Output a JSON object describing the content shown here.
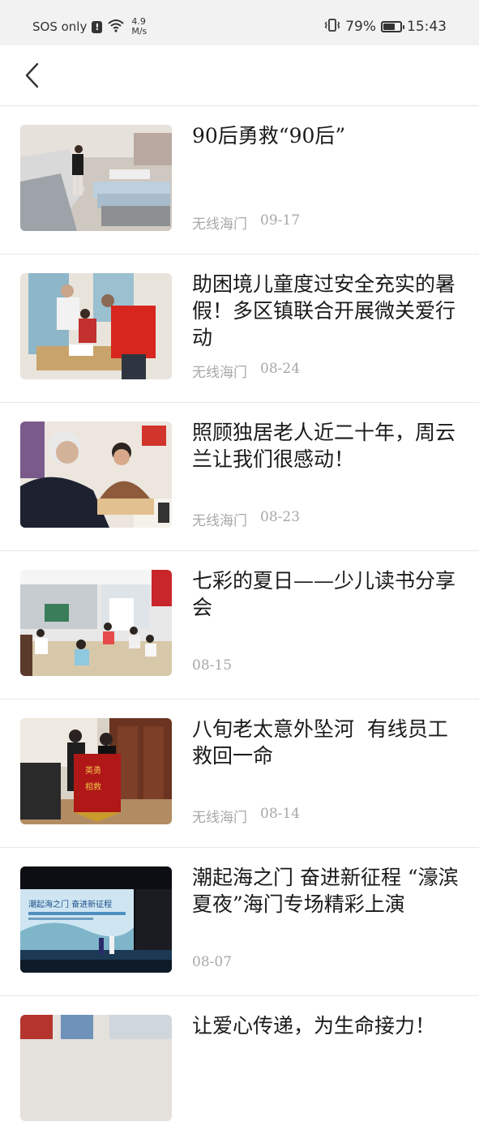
{
  "status_bar": {
    "carrier": "SOS only",
    "speed_value": "4.9",
    "speed_unit": "M/s",
    "battery": "79%",
    "battery_level": 0.79,
    "time": "15:43"
  },
  "nav": {
    "back_icon": "chevron-left-icon"
  },
  "articles": [
    {
      "title": "90后勇救“90后”",
      "source": "无线海门",
      "date": "09-17"
    },
    {
      "title": "助困境儿童度过安全充实的暑假！多区镇联合开展微关爱行动",
      "source": "无线海门",
      "date": "08-24"
    },
    {
      "title": "照顾独居老人近二十年，周云兰让我们很感动！",
      "source": "无线海门",
      "date": "08-23"
    },
    {
      "title": "七彩的夏日——少儿读书分享会",
      "source": "",
      "date": "08-15"
    },
    {
      "title": "八旬老太意外坠河  有线员工救回一命",
      "source": "无线海门",
      "date": "08-14"
    },
    {
      "title": "潮起海之门 奋进新征程 “濠滨夏夜”海门专场精彩上演",
      "source": "",
      "date": "08-07"
    },
    {
      "title": "让爱心传递，为生命接力！",
      "source": "",
      "date": ""
    }
  ],
  "thumb_texts": {
    "stage_banner": "潮起海之门 奋进新征程",
    "banner_chars": "英勇相救"
  }
}
